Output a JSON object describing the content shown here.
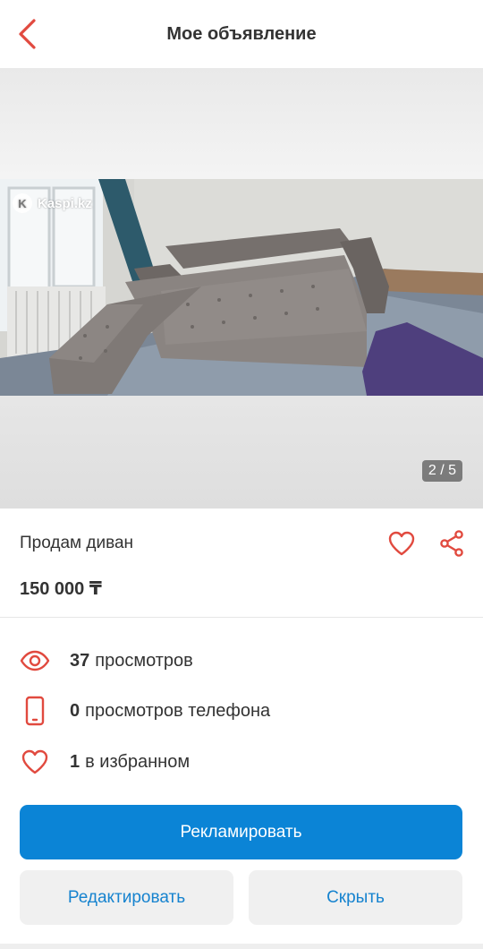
{
  "header": {
    "title": "Мое объявление",
    "back_icon": "chevron-left-icon"
  },
  "gallery": {
    "watermark": "Kaspi.kz",
    "counter": "2 / 5"
  },
  "listing": {
    "title": "Продам диван",
    "price": "150 000 ₸",
    "favorite_icon": "heart-icon",
    "share_icon": "share-icon"
  },
  "stats": [
    {
      "icon": "eye-icon",
      "count": "37",
      "label": "просмотров"
    },
    {
      "icon": "phone-icon",
      "count": "0",
      "label": "просмотров телефона"
    },
    {
      "icon": "heart-icon",
      "count": "1",
      "label": "в избранном"
    }
  ],
  "actions": {
    "promote_label": "Рекламировать",
    "edit_label": "Редактировать",
    "hide_label": "Скрыть"
  },
  "colors": {
    "accent_red": "#e14a3f",
    "primary_blue": "#0b84d6",
    "link_blue": "#1683cf"
  }
}
